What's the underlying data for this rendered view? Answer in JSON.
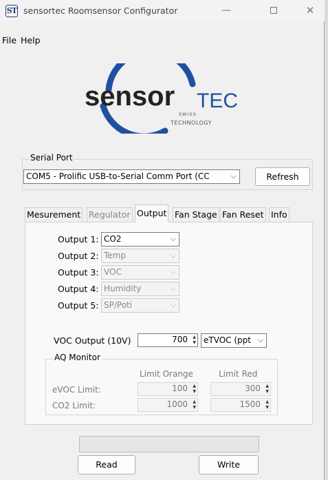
{
  "window": {
    "icon_text": "ST",
    "title": "sensortec Roomsensor Configurator",
    "minimize_glyph": "—",
    "close_glyph": "✕"
  },
  "menu": {
    "file": "File",
    "help": "Help"
  },
  "logo": {
    "sensor": "sensor",
    "tec": "TEC",
    "swiss": "SWISS",
    "technology": "TECHNOLOGY",
    "ring_color": "#1f4fa0"
  },
  "serial": {
    "label": "Serial Port",
    "port_value": "COM5 - Prolific USB-to-Serial Comm Port (CC",
    "refresh_label": "Refresh"
  },
  "tabs": [
    {
      "label": "Mesurement",
      "state": "normal"
    },
    {
      "label": "Regulator",
      "state": "disabled"
    },
    {
      "label": "Output",
      "state": "active"
    },
    {
      "label": "Fan Stage",
      "state": "normal"
    },
    {
      "label": "Fan Reset",
      "state": "normal"
    },
    {
      "label": "Info",
      "state": "normal"
    }
  ],
  "outputs": [
    {
      "label": "Output 1:",
      "value": "CO2",
      "enabled": true
    },
    {
      "label": "Output 2:",
      "value": "Temp",
      "enabled": false
    },
    {
      "label": "Output 3:",
      "value": "VOC",
      "enabled": false
    },
    {
      "label": "Output 4:",
      "value": "Humidity",
      "enabled": false
    },
    {
      "label": "Output 5:",
      "value": "SP/Poti",
      "enabled": false
    }
  ],
  "voc_output": {
    "label": "VOC Output (10V)",
    "value": "700",
    "unit_value": "eTVOC (ppt"
  },
  "aq_monitor": {
    "label": "AQ Monitor",
    "col_orange": "Limit Orange",
    "col_red": "Limit Red",
    "evoc_label": "eVOC Limit:",
    "evoc_orange": "100",
    "evoc_red": "300",
    "co2_label": "CO2 Limit:",
    "co2_orange": "1000",
    "co2_red": "1500"
  },
  "progress": {
    "value": 0
  },
  "buttons": {
    "read": "Read",
    "write": "Write"
  },
  "icons": {
    "dropdown": "chevron-down-icon",
    "spinner": "spin-arrows-icon"
  }
}
